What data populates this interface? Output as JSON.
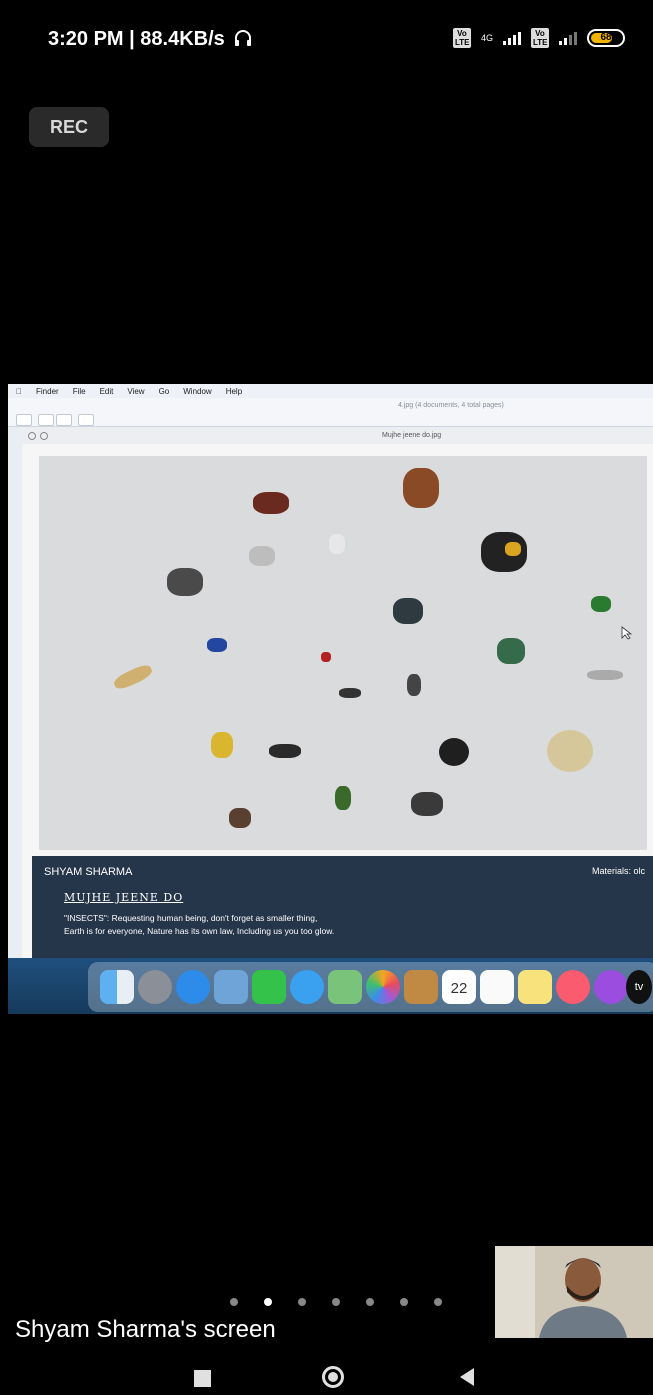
{
  "status_bar": {
    "time_speed": "3:20 PM | 88.4KB/s",
    "headphone_icon": "headphones-icon",
    "volte1": "Vo LTE",
    "network": "4G",
    "volte2": "Vo LTE",
    "battery": "68"
  },
  "recording": {
    "label": "REC"
  },
  "shared_screen": {
    "mac_menu": [
      "Finder",
      "File",
      "Edit",
      "View",
      "Go",
      "Window",
      "Help"
    ],
    "preview_doc_count": "4.jpg (4 documents, 4 total pages)",
    "inner_window_title": "Mujhe jeene do.jpg",
    "caption": {
      "artist": "SHYAM SHARMA",
      "title": "MUJHE JEENE DO",
      "line1": "\"INSECTS\": Requesting  human being, don't forget as smaller thing,",
      "line2": "Earth is for everyone, Nature has its own law, Including us you too glow.",
      "materials": "Materials: olc"
    },
    "dock_icons": [
      "finder-icon",
      "launchpad-icon",
      "safari-icon",
      "preview-icon",
      "facetime-icon",
      "messages-icon",
      "maps-icon",
      "photos-icon",
      "contacts-icon",
      "calendar-icon",
      "reminders-icon",
      "notes-icon",
      "music-icon",
      "podcasts-icon",
      "tv-icon"
    ],
    "calendar_day": "22",
    "tv_label": "tv"
  },
  "meeting": {
    "page_dots": 7,
    "active_dot_index": 1,
    "screen_owner": "Shyam Sharma's screen"
  },
  "colors": {
    "caption_bg": "#25354a",
    "battery_fill": "#f2b300"
  }
}
